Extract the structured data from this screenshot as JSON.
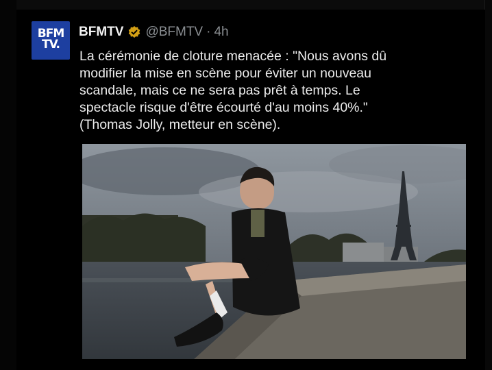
{
  "post": {
    "avatar_text": "BFM\nTV.",
    "display_name": "BFMTV",
    "verified_badge_color": "#d4a015",
    "handle": "@BFMTV",
    "separator": "·",
    "time": "4h",
    "text": "La cérémonie de cloture menacée : \"Nous avons dû\nmodifier la mise en scène pour éviter un nouveau\nscandale, mais ce ne sera pas prêt à temps. Le\nspectacle risque d'être écourté d'au moins 40%.\"\n(Thomas Jolly, metteur en scène)."
  },
  "colors": {
    "background": "#000000",
    "avatar_bg": "#1d3fa0",
    "secondary_text": "#8b8f93"
  }
}
